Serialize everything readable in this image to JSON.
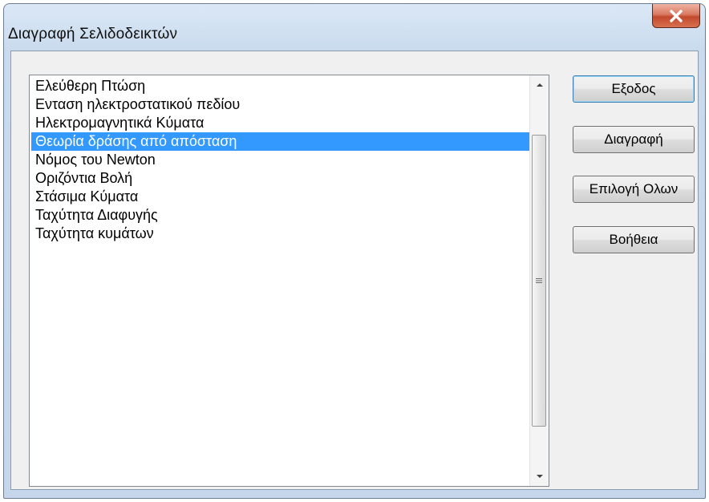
{
  "window": {
    "title": "Διαγραφή Σελιδοδεικτών",
    "close_icon": "close-x-icon"
  },
  "bookmarks": {
    "items": [
      "Ελεύθερη Πτώση",
      "Ενταση ηλεκτροστατικού πεδίου",
      "Ηλεκτρομαγνητικά Κύματα",
      "Θεωρία δράσης από απόσταση",
      "Νόμος του Newton",
      "Οριζόντια Βολή",
      "Στάσιμα Κύματα",
      "Ταχύτητα Διαφυγής",
      "Ταχύτητα κυμάτων"
    ],
    "selected_index": 3
  },
  "buttons": {
    "exit": "Εξοδος",
    "delete": "Διαγραφή",
    "select_all": "Επιλογή Ολων",
    "help": "Βοήθεια"
  },
  "colors": {
    "selection": "#3399ff",
    "close_button": "#c94a30"
  }
}
